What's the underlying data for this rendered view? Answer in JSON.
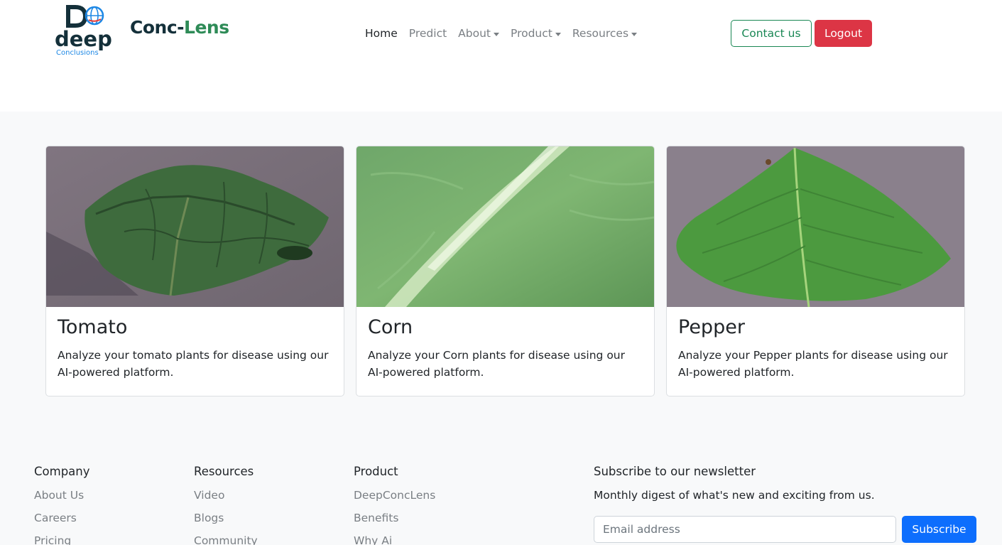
{
  "header": {
    "logo_text": "deep",
    "logo_subtext": "Conclusions",
    "brand_part1": "Conc-",
    "brand_part2": "Lens",
    "nav": [
      {
        "label": "Home",
        "active": true,
        "dropdown": false
      },
      {
        "label": "Predict",
        "active": false,
        "dropdown": false
      },
      {
        "label": "About",
        "active": false,
        "dropdown": true
      },
      {
        "label": "Product",
        "active": false,
        "dropdown": true
      },
      {
        "label": "Resources",
        "active": false,
        "dropdown": true
      }
    ],
    "contact_label": "Contact us",
    "logout_label": "Logout"
  },
  "cards": [
    {
      "title": "Tomato",
      "text": "Analyze your tomato plants for disease using our AI-powered platform."
    },
    {
      "title": "Corn",
      "text": "Analyze your Corn plants for disease using our AI-powered platform."
    },
    {
      "title": "Pepper",
      "text": "Analyze your Pepper plants for disease using our AI-powered platform."
    }
  ],
  "footer": {
    "company": {
      "heading": "Company",
      "links": [
        "About Us",
        "Careers",
        "Pricing"
      ]
    },
    "resources": {
      "heading": "Resources",
      "links": [
        "Video",
        "Blogs",
        "Community"
      ]
    },
    "product": {
      "heading": "Product",
      "links": [
        "DeepConcLens",
        "Benefits",
        "Why Ai"
      ]
    },
    "newsletter": {
      "heading": "Subscribe to our newsletter",
      "description": "Monthly digest of what's new and exciting from us.",
      "email_placeholder": "Email address",
      "subscribe_label": "Subscribe"
    }
  },
  "colors": {
    "brand_dark": "#14303a",
    "brand_green": "#2e8b57",
    "contact_outline": "#198754",
    "logout_red": "#dc3545",
    "subscribe_blue": "#0d6efd",
    "page_bg": "#f8f9fa"
  }
}
